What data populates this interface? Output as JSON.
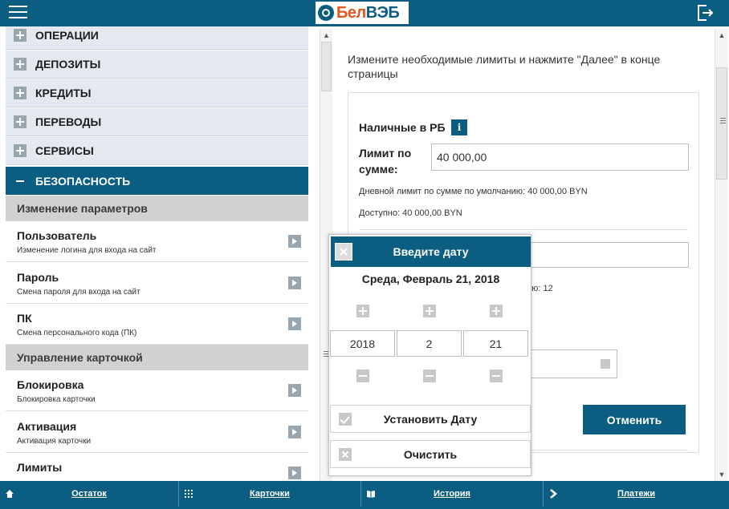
{
  "header": {
    "logo_part1": "Бел",
    "logo_part2": "ВЭБ"
  },
  "menu": {
    "categories": [
      {
        "label": "ОПЕРАЦИИ"
      },
      {
        "label": "ДЕПОЗИТЫ"
      },
      {
        "label": "КРЕДИТЫ"
      },
      {
        "label": "ПЕРЕВОДЫ"
      },
      {
        "label": "СЕРВИСЫ"
      },
      {
        "label": "БЕЗОПАСНОСТЬ"
      }
    ],
    "sections": [
      {
        "title": "Изменение параметров"
      },
      {
        "title": "Управление карточкой"
      }
    ],
    "items": [
      {
        "title": "Пользователь",
        "subtitle": "Изменение логина для входа на сайт"
      },
      {
        "title": "Пароль",
        "subtitle": "Смена пароля для входа на сайт"
      },
      {
        "title": "ПК",
        "subtitle": "Смена персонального кода (ПК)"
      },
      {
        "title": "Блокировка",
        "subtitle": "Блокировка карточки"
      },
      {
        "title": "Активация",
        "subtitle": "Активация карточки"
      },
      {
        "title": "Лимиты",
        "subtitle": ""
      }
    ]
  },
  "content": {
    "intro": "Измените необходимые лимиты и нажмите \"Далее\" в конце страницы",
    "cash_label": "Наличные в РБ",
    "info_glyph": "i",
    "limit_label_1": "Лимит по",
    "limit_label_2": "сумме:",
    "limit_value": "40 000,00",
    "default_limit_text": "Дневной лимит по сумме по умолчанию: 40 000,00 BYN",
    "available_text": "Доступно: 40 000,00 BYN",
    "count_text_fragment": "ию: 12",
    "cancel_button": "Отменить"
  },
  "datepicker": {
    "title": "Введите дату",
    "current_date": "Среда, Февраль 21, 2018",
    "year": "2018",
    "month": "2",
    "day": "21",
    "set_date_button": "Установить Дату",
    "clear_button": "Очистить"
  },
  "bottom_nav": [
    {
      "label": "Остаток",
      "icon": "home-icon"
    },
    {
      "label": "Карточки",
      "icon": "grid-icon"
    },
    {
      "label": "История",
      "icon": "book-icon"
    },
    {
      "label": "Платежи",
      "icon": "chevron-right-icon"
    }
  ],
  "colors": {
    "brand": "#0b5d82",
    "logo_accent": "#e2571d"
  }
}
